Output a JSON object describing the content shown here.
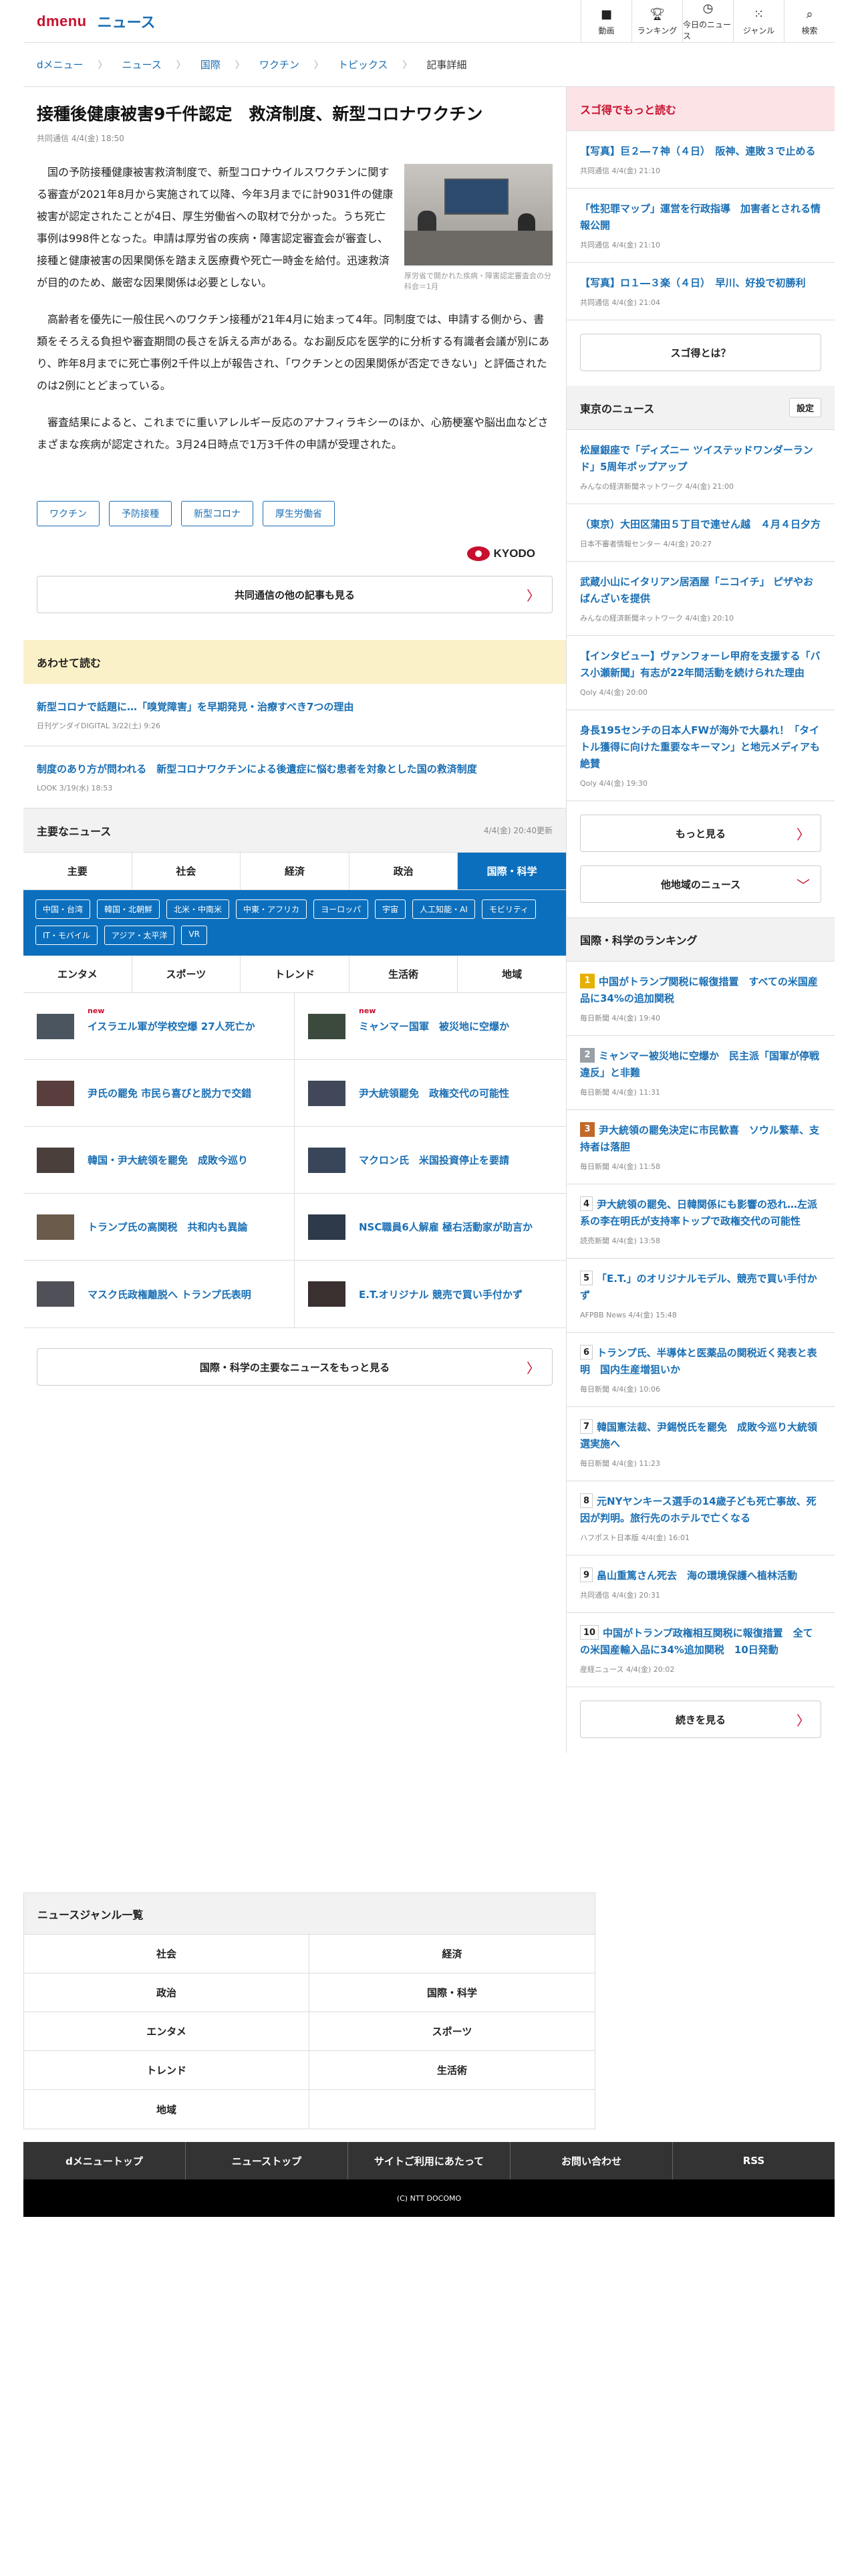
{
  "header": {
    "logo": "dmenu",
    "sub": "ニュース",
    "nav": [
      {
        "label": "動画",
        "icon": "video-icon"
      },
      {
        "label": "ランキング",
        "icon": "trophy-icon"
      },
      {
        "label": "今日のニュース",
        "icon": "clock-icon"
      },
      {
        "label": "ジャンル",
        "icon": "grid-icon"
      },
      {
        "label": "検索",
        "icon": "search-icon"
      }
    ]
  },
  "breadcrumb": [
    "dメニュー",
    "ニュース",
    "国際",
    "ワクチン",
    "トピックス"
  ],
  "breadcrumb_current": "記事詳細",
  "article": {
    "title": "接種後健康被害9千件認定　救済制度、新型コロナワクチン",
    "meta": "共同通信 4/4(金) 18:50",
    "photo_caption": "厚労省で開かれた疾病・障害認定審査会の分科会＝1月",
    "paragraphs": [
      "国の予防接種健康被害救済制度で、新型コロナウイルスワクチンに関する審査が2021年8月から実施されて以降、今年3月までに計9031件の健康被害が認定されたことが4日、厚生労働省への取材で分かった。うち死亡事例は998件となった。申請は厚労省の疾病・障害認定審査会が審査し、接種と健康被害の因果関係を踏まえ医療費や死亡一時金を給付。迅速救済が目的のため、厳密な因果関係は必要としない。",
      "高齢者を優先に一般住民へのワクチン接種が21年4月に始まって4年。同制度では、申請する側から、書類をそろえる負担や審査期間の長さを訴える声がある。なお副反応を医学的に分析する有識者会議が別にあり、昨年8月までに死亡事例2千件以上が報告され、「ワクチンとの因果関係が否定できない」と評価されたのは2例にとどまっている。",
      "審査結果によると、これまでに重いアレルギー反応のアナフィラキシーのほか、心筋梗塞や脳出血などさまざまな疾病が認定された。3月24日時点で1万3千件の申請が受理された。"
    ],
    "tags": [
      "ワクチン",
      "予防接種",
      "新型コロナ",
      "厚生労働省"
    ],
    "source_logo": "KYODO",
    "more_button": "共同通信の他の記事も見る"
  },
  "also_read": {
    "title": "あわせて読む",
    "items": [
      {
        "title": "新型コロナで話題に…「嗅覚障害」を早期発見・治療すべき7つの理由",
        "meta": "日刊ゲンダイDIGITAL 3/22(土) 9:26"
      },
      {
        "title": "制度のあり方が問われる　新型コロナワクチンによる後遺症に悩む患者を対象とした国の救済制度",
        "meta": "LOOK 3/19(水) 18:53"
      }
    ]
  },
  "major": {
    "title": "主要なニュース",
    "updated": "4/4(金) 20:40更新",
    "tabs": [
      "主要",
      "社会",
      "経済",
      "政治",
      "国際・科学"
    ],
    "subtags": [
      "中国・台湾",
      "韓国・北朝鮮",
      "北米・中南米",
      "中東・アフリカ",
      "ヨーロッパ",
      "宇宙",
      "人工知能・AI",
      "モビリティ",
      "IT・モバイル",
      "アジア・太平洋",
      "VR"
    ],
    "tabs2": [
      "エンタメ",
      "スポーツ",
      "トレンド",
      "生活術",
      "地域"
    ],
    "new_label": "new",
    "items": [
      {
        "title": "イスラエル軍が学校空爆 27人死亡か",
        "new": true
      },
      {
        "title": "ミャンマー国軍　被災地に空爆か",
        "new": true
      },
      {
        "title": "尹氏の罷免 市民ら喜びと脱力で交錯",
        "new": false
      },
      {
        "title": "尹大統領罷免　政権交代の可能性",
        "new": false
      },
      {
        "title": "韓国・尹大統領を罷免　成敗今巡り",
        "new": false
      },
      {
        "title": "マクロン氏　米国投資停止を要請",
        "new": false
      },
      {
        "title": "トランプ氏の高関税　共和内も異論",
        "new": false
      },
      {
        "title": "NSC職員6人解雇 極右活動家が助言か",
        "new": false
      },
      {
        "title": "マスク氏政権離脱へ トランプ氏表明",
        "new": false
      },
      {
        "title": "E.T.オリジナル 競売で買い手付かず",
        "new": false
      }
    ],
    "more_button": "国際・科学の主要なニュースをもっと見る"
  },
  "sidebar": {
    "sugo_title": "スゴ得でもっと読む",
    "sugo_items": [
      {
        "title": "【写真】巨２―７神（４日）　阪神、連敗３で止める",
        "meta": "共同通信 4/4(金) 21:10"
      },
      {
        "title": "「性犯罪マップ」運営を行政指導　加害者とされる情報公開",
        "meta": "共同通信 4/4(金) 21:10"
      },
      {
        "title": "【写真】ロ１―３楽（４日）　早川、好投で初勝利",
        "meta": "共同通信 4/4(金) 21:04"
      }
    ],
    "sugo_button": "スゴ得とは？",
    "tokyo_title": "東京のニュース",
    "tokyo_setting": "設定",
    "tokyo_items": [
      {
        "title": "松屋銀座で「ディズニー ツイステッドワンダーランド」5周年ポップアップ",
        "meta": "みんなの経済新聞ネットワーク 4/4(金) 21:00"
      },
      {
        "title": "（東京）大田区蒲田５丁目で連せん越　４月４日夕方",
        "meta": "日本不審者情報センター 4/4(金) 20:27"
      },
      {
        "title": "武蔵小山にイタリアン居酒屋「ニコイチ」 ピザやおばんざいを提供",
        "meta": "みんなの経済新聞ネットワーク 4/4(金) 20:10"
      },
      {
        "title": "【インタビュー】ヴァンフォーレ甲府を支援する「バス小瀬新聞」有志が22年間活動を続けられた理由",
        "meta": "Qoly 4/4(金) 20:00"
      },
      {
        "title": "身長195センチの日本人FWが海外で大暴れ！「タイトル獲得に向けた重要なキーマン」と地元メディアも絶賛",
        "meta": "Qoly 4/4(金) 19:30"
      }
    ],
    "tokyo_more": "もっと見る",
    "other_region": "他地域のニュース",
    "ranking_title": "国際・科学のランキング",
    "ranking": [
      {
        "rank": "1",
        "title": "中国がトランプ関税に報復措置　すべての米国産品に34%の追加関税",
        "meta": "毎日新聞 4/4(金) 19:40"
      },
      {
        "rank": "2",
        "title": "ミャンマー被災地に空爆か　民主派「国軍が停戦違反」と非難",
        "meta": "毎日新聞 4/4(金) 11:31"
      },
      {
        "rank": "3",
        "title": "尹大統領の罷免決定に市民歓喜　ソウル繁華、支持者は落胆",
        "meta": "毎日新聞 4/4(金) 11:58"
      },
      {
        "rank": "4",
        "title": "尹大統領の罷免、日韓関係にも影響の恐れ…左派系の李在明氏が支持率トップで政権交代の可能性",
        "meta": "読売新聞 4/4(金) 13:58"
      },
      {
        "rank": "5",
        "title": "「E.T.」のオリジナルモデル、競売で買い手付かず",
        "meta": "AFPBB News 4/4(金) 15:48"
      },
      {
        "rank": "6",
        "title": "トランプ氏、半導体と医薬品の関税近く発表と表明　国内生産増狙いか",
        "meta": "毎日新聞 4/4(金) 10:06"
      },
      {
        "rank": "7",
        "title": "韓国憲法裁、尹錫悦氏を罷免　成敗今巡り大統領選実施へ",
        "meta": "毎日新聞 4/4(金) 11:23"
      },
      {
        "rank": "8",
        "title": "元NYヤンキース選手の14歳子ども死亡事故、死因が判明。旅行先のホテルで亡くなる",
        "meta": "ハフポスト日本版 4/4(金) 16:01"
      },
      {
        "rank": "9",
        "title": "畠山重篤さん死去　海の環境保護へ植林活動",
        "meta": "共同通信 4/4(金) 20:31"
      },
      {
        "rank": "10",
        "title": "中国がトランプ政権相互関税に報復措置　全ての米国産輸入品に34%追加関税　10日発動",
        "meta": "産経ニュース 4/4(金) 20:02"
      }
    ],
    "ranking_more": "続きを見る"
  },
  "genre": {
    "title": "ニュースジャンル一覧",
    "items": [
      "社会",
      "経済",
      "政治",
      "国際・科学",
      "エンタメ",
      "スポーツ",
      "トレンド",
      "生活術",
      "地域",
      ""
    ]
  },
  "footer": {
    "nav": [
      "dメニュートップ",
      "ニューストップ",
      "サイトご利用にあたって",
      "お問い合わせ",
      "RSS"
    ],
    "copyright": "(C) NTT DOCOMO"
  },
  "colors": {
    "brand": "#c8102e",
    "link": "#1a6fb4",
    "tab_active": "#0c6fbd"
  }
}
